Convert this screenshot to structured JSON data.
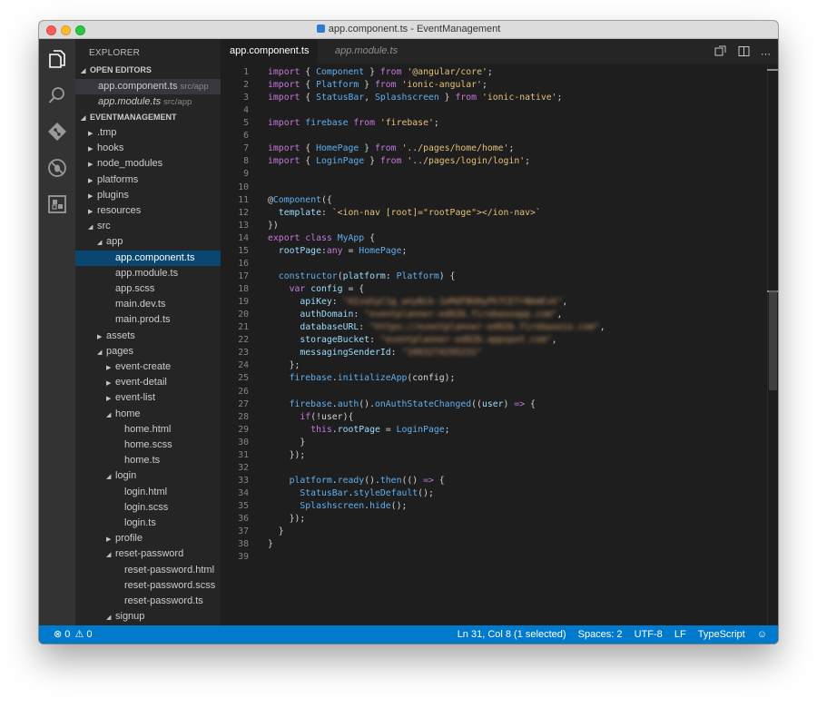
{
  "window": {
    "title": "app.component.ts - EventManagement"
  },
  "sidebar": {
    "header": "EXPLORER",
    "open_editors_label": "OPEN EDITORS",
    "open_editors": [
      {
        "name": "app.component.ts",
        "hint": "src/app"
      },
      {
        "name": "app.module.ts",
        "hint": "src/app"
      }
    ],
    "project_label": "EVENTMANAGEMENT",
    "tree": [
      {
        "label": ".tmp",
        "depth": 0,
        "folder": true,
        "open": false
      },
      {
        "label": "hooks",
        "depth": 0,
        "folder": true,
        "open": false
      },
      {
        "label": "node_modules",
        "depth": 0,
        "folder": true,
        "open": false
      },
      {
        "label": "platforms",
        "depth": 0,
        "folder": true,
        "open": false
      },
      {
        "label": "plugins",
        "depth": 0,
        "folder": true,
        "open": false
      },
      {
        "label": "resources",
        "depth": 0,
        "folder": true,
        "open": false
      },
      {
        "label": "src",
        "depth": 0,
        "folder": true,
        "open": true
      },
      {
        "label": "app",
        "depth": 1,
        "folder": true,
        "open": true
      },
      {
        "label": "app.component.ts",
        "depth": 2,
        "folder": false,
        "selected": true
      },
      {
        "label": "app.module.ts",
        "depth": 2,
        "folder": false
      },
      {
        "label": "app.scss",
        "depth": 2,
        "folder": false
      },
      {
        "label": "main.dev.ts",
        "depth": 2,
        "folder": false
      },
      {
        "label": "main.prod.ts",
        "depth": 2,
        "folder": false
      },
      {
        "label": "assets",
        "depth": 1,
        "folder": true,
        "open": false
      },
      {
        "label": "pages",
        "depth": 1,
        "folder": true,
        "open": true
      },
      {
        "label": "event-create",
        "depth": 2,
        "folder": true,
        "open": false
      },
      {
        "label": "event-detail",
        "depth": 2,
        "folder": true,
        "open": false
      },
      {
        "label": "event-list",
        "depth": 2,
        "folder": true,
        "open": false
      },
      {
        "label": "home",
        "depth": 2,
        "folder": true,
        "open": true
      },
      {
        "label": "home.html",
        "depth": 3,
        "folder": false
      },
      {
        "label": "home.scss",
        "depth": 3,
        "folder": false
      },
      {
        "label": "home.ts",
        "depth": 3,
        "folder": false
      },
      {
        "label": "login",
        "depth": 2,
        "folder": true,
        "open": true
      },
      {
        "label": "login.html",
        "depth": 3,
        "folder": false
      },
      {
        "label": "login.scss",
        "depth": 3,
        "folder": false
      },
      {
        "label": "login.ts",
        "depth": 3,
        "folder": false
      },
      {
        "label": "profile",
        "depth": 2,
        "folder": true,
        "open": false
      },
      {
        "label": "reset-password",
        "depth": 2,
        "folder": true,
        "open": true
      },
      {
        "label": "reset-password.html",
        "depth": 3,
        "folder": false
      },
      {
        "label": "reset-password.scss",
        "depth": 3,
        "folder": false
      },
      {
        "label": "reset-password.ts",
        "depth": 3,
        "folder": false
      },
      {
        "label": "signup",
        "depth": 2,
        "folder": true,
        "open": true
      }
    ]
  },
  "tabs": [
    {
      "label": "app.component.ts",
      "active": true
    },
    {
      "label": "app.module.ts",
      "active": false
    }
  ],
  "editor": {
    "lines": [
      [
        [
          "k",
          "import "
        ],
        [
          "p",
          "{ "
        ],
        [
          "t",
          "Component"
        ],
        [
          "p",
          " } "
        ],
        [
          "k",
          "from "
        ],
        [
          "s",
          "'@angular/core'"
        ],
        [
          "p",
          ";"
        ]
      ],
      [
        [
          "k",
          "import "
        ],
        [
          "p",
          "{ "
        ],
        [
          "t",
          "Platform"
        ],
        [
          "p",
          " } "
        ],
        [
          "k",
          "from "
        ],
        [
          "s",
          "'ionic-angular'"
        ],
        [
          "p",
          ";"
        ]
      ],
      [
        [
          "k",
          "import "
        ],
        [
          "p",
          "{ "
        ],
        [
          "t",
          "StatusBar"
        ],
        [
          "p",
          ", "
        ],
        [
          "t",
          "Splashscreen"
        ],
        [
          "p",
          " } "
        ],
        [
          "k",
          "from "
        ],
        [
          "s",
          "'ionic-native'"
        ],
        [
          "p",
          ";"
        ]
      ],
      [],
      [
        [
          "k",
          "import "
        ],
        [
          "t",
          "firebase "
        ],
        [
          "k",
          "from "
        ],
        [
          "s",
          "'firebase'"
        ],
        [
          "p",
          ";"
        ]
      ],
      [],
      [
        [
          "k",
          "import "
        ],
        [
          "p",
          "{ "
        ],
        [
          "t",
          "HomePage"
        ],
        [
          "p",
          " } "
        ],
        [
          "k",
          "from "
        ],
        [
          "s",
          "'../pages/home/home'"
        ],
        [
          "p",
          ";"
        ]
      ],
      [
        [
          "k",
          "import "
        ],
        [
          "p",
          "{ "
        ],
        [
          "t",
          "LoginPage"
        ],
        [
          "p",
          " } "
        ],
        [
          "k",
          "from "
        ],
        [
          "s",
          "'../pages/login/login'"
        ],
        [
          "p",
          ";"
        ]
      ],
      [],
      [],
      [
        [
          "p",
          "@"
        ],
        [
          "t",
          "Component"
        ],
        [
          "p",
          "({"
        ]
      ],
      [
        [
          "p",
          "  "
        ],
        [
          "f",
          "template"
        ],
        [
          "p",
          ": "
        ],
        [
          "s",
          "`<ion-nav [root]=\"rootPage\"></ion-nav>`"
        ]
      ],
      [
        [
          "p",
          "})"
        ]
      ],
      [
        [
          "k",
          "export "
        ],
        [
          "k",
          "class "
        ],
        [
          "t",
          "MyApp "
        ],
        [
          "p",
          "{"
        ]
      ],
      [
        [
          "p",
          "  "
        ],
        [
          "f",
          "rootPage"
        ],
        [
          "p",
          ":"
        ],
        [
          "k",
          "any"
        ],
        [
          "p",
          " = "
        ],
        [
          "t",
          "HomePage"
        ],
        [
          "p",
          ";"
        ]
      ],
      [],
      [
        [
          "p",
          "  "
        ],
        [
          "t",
          "constructor"
        ],
        [
          "p",
          "("
        ],
        [
          "f",
          "platform"
        ],
        [
          "p",
          ": "
        ],
        [
          "t",
          "Platform"
        ],
        [
          "p",
          ") {"
        ]
      ],
      [
        [
          "p",
          "    "
        ],
        [
          "k",
          "var "
        ],
        [
          "f",
          "config"
        ],
        [
          "p",
          " = {"
        ]
      ],
      [
        [
          "p",
          "      "
        ],
        [
          "f",
          "apiKey"
        ],
        [
          "p",
          ": "
        ],
        [
          "b",
          "\"AIzaSyC1g_wnyNik-1eMdFBUHyPh7CEfrNbmEvk\""
        ],
        [
          "p",
          ","
        ]
      ],
      [
        [
          "p",
          "      "
        ],
        [
          "f",
          "authDomain"
        ],
        [
          "p",
          ": "
        ],
        [
          "b",
          "\"eventplanner-ed92b.firebaseapp.com\""
        ],
        [
          "p",
          ","
        ]
      ],
      [
        [
          "p",
          "      "
        ],
        [
          "f",
          "databaseURL"
        ],
        [
          "p",
          ": "
        ],
        [
          "b",
          "\"https://eventplanner-ed92b.firebaseio.com\""
        ],
        [
          "p",
          ","
        ]
      ],
      [
        [
          "p",
          "      "
        ],
        [
          "f",
          "storageBucket"
        ],
        [
          "p",
          ": "
        ],
        [
          "b",
          "\"eventplanner-ed92b.appspot.com\""
        ],
        [
          "p",
          ","
        ]
      ],
      [
        [
          "p",
          "      "
        ],
        [
          "f",
          "messagingSenderId"
        ],
        [
          "p",
          ": "
        ],
        [
          "b",
          "\"1093274295231\""
        ]
      ],
      [
        [
          "p",
          "    };"
        ]
      ],
      [
        [
          "p",
          "    "
        ],
        [
          "t",
          "firebase"
        ],
        [
          "p",
          "."
        ],
        [
          "t",
          "initializeApp"
        ],
        [
          "p",
          "(config);"
        ]
      ],
      [],
      [
        [
          "p",
          "    "
        ],
        [
          "t",
          "firebase"
        ],
        [
          "p",
          "."
        ],
        [
          "t",
          "auth"
        ],
        [
          "p",
          "()."
        ],
        [
          "t",
          "onAuthStateChanged"
        ],
        [
          "p",
          "(("
        ],
        [
          "f",
          "user"
        ],
        [
          "p",
          ") "
        ],
        [
          "k",
          "=>"
        ],
        [
          "p",
          " {"
        ]
      ],
      [
        [
          "p",
          "      "
        ],
        [
          "k",
          "if"
        ],
        [
          "p",
          "(!user){"
        ]
      ],
      [
        [
          "p",
          "        "
        ],
        [
          "k",
          "this"
        ],
        [
          "p",
          "."
        ],
        [
          "f",
          "rootPage"
        ],
        [
          "p",
          " = "
        ],
        [
          "t",
          "LoginPage"
        ],
        [
          "p",
          ";"
        ]
      ],
      [
        [
          "p",
          "      }"
        ]
      ],
      [
        [
          "p",
          "    });"
        ]
      ],
      [],
      [
        [
          "p",
          "    "
        ],
        [
          "t",
          "platform"
        ],
        [
          "p",
          "."
        ],
        [
          "t",
          "ready"
        ],
        [
          "p",
          "()."
        ],
        [
          "t",
          "then"
        ],
        [
          "p",
          "(() "
        ],
        [
          "k",
          "=>"
        ],
        [
          "p",
          " {"
        ]
      ],
      [
        [
          "p",
          "      "
        ],
        [
          "t",
          "StatusBar"
        ],
        [
          "p",
          "."
        ],
        [
          "t",
          "styleDefault"
        ],
        [
          "p",
          "();"
        ]
      ],
      [
        [
          "p",
          "      "
        ],
        [
          "t",
          "Splashscreen"
        ],
        [
          "p",
          "."
        ],
        [
          "t",
          "hide"
        ],
        [
          "p",
          "();"
        ]
      ],
      [
        [
          "p",
          "    });"
        ]
      ],
      [
        [
          "p",
          "  }"
        ]
      ],
      [
        [
          "p",
          "}"
        ]
      ],
      []
    ]
  },
  "status": {
    "errors": "0",
    "warnings": "0",
    "position": "Ln 31, Col 8 (1 selected)",
    "spaces": "Spaces: 2",
    "encoding": "UTF-8",
    "eol": "LF",
    "language": "TypeScript"
  },
  "colors": {
    "accent": "#007acc",
    "selection": "#094771",
    "keyword": "#c678dd",
    "string": "#e5c07b",
    "type": "#61afef"
  }
}
